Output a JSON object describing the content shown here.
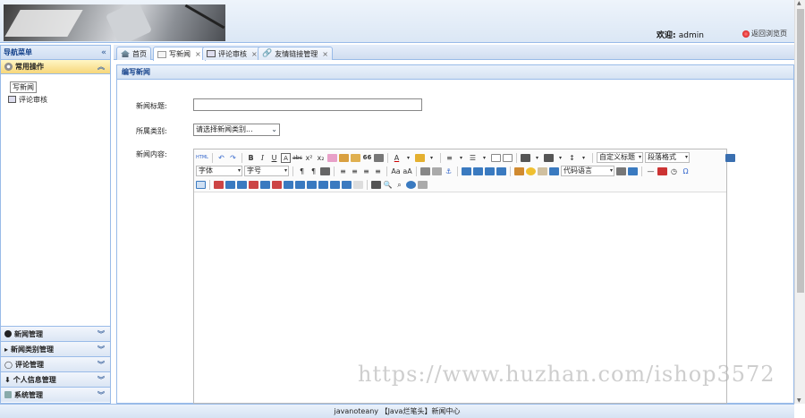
{
  "header": {
    "welcome_label": "欢迎:",
    "username": "admin",
    "back_link": "返回浏览页"
  },
  "sidebar": {
    "title": "导航菜单",
    "active_group": "常用操作",
    "items": [
      {
        "label": "写新闻"
      },
      {
        "label": "评论审核"
      }
    ],
    "groups": [
      {
        "label": "新闻管理"
      },
      {
        "label": "新闻类别管理"
      },
      {
        "label": "评论管理"
      },
      {
        "label": "个人信息管理"
      },
      {
        "label": "系统管理"
      }
    ]
  },
  "tabs": [
    {
      "label": "首页",
      "closable": false
    },
    {
      "label": "写新闻",
      "closable": true
    },
    {
      "label": "评论审核",
      "closable": true
    },
    {
      "label": "友情链接管理",
      "closable": true
    }
  ],
  "panel": {
    "title": "编写新闻"
  },
  "form": {
    "title_label": "新闻标题:",
    "title_value": "",
    "category_label": "所属类别:",
    "category_selected": "请选择新闻类别...",
    "content_label": "新闻内容:"
  },
  "editor": {
    "html_button": "HTML",
    "bold": "B",
    "italic": "I",
    "underline": "U",
    "font_letter": "A",
    "quote": "66",
    "omega": "Ω",
    "custom_heading": "自定义标题",
    "paragraph_format": "段落格式",
    "font_family": "字体",
    "font_size": "字号",
    "code_language": "代码语言"
  },
  "footer": {
    "text": "javanoteany 【Java烂笔头】新闻中心"
  },
  "watermark": "https://www.huzhan.com/ishop3572"
}
